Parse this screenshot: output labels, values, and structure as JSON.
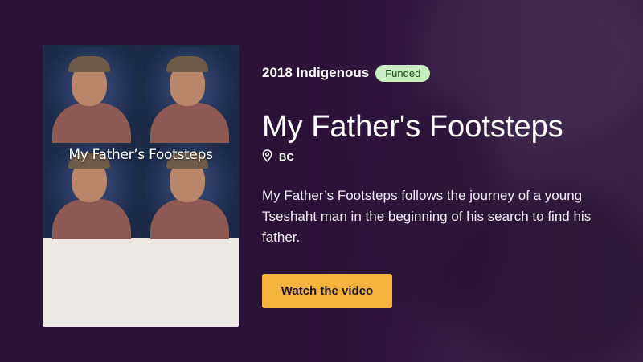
{
  "project": {
    "category": "2018 Indigenous",
    "status_badge": "Funded",
    "title": "My Father's Footsteps",
    "location": "BC",
    "description": "My Father’s Footsteps follows the journey of a young Tseshaht man in the beginning of his search to find his father.",
    "cta_label": "Watch the video"
  },
  "poster": {
    "overlay_text": "My Father’s Footsteps"
  },
  "icons": {
    "location": "map-pin-icon"
  },
  "colors": {
    "background": "#2b1239",
    "badge_bg": "#c9efc1",
    "badge_text": "#1d4b1f",
    "cta_bg": "#f3b33d"
  }
}
